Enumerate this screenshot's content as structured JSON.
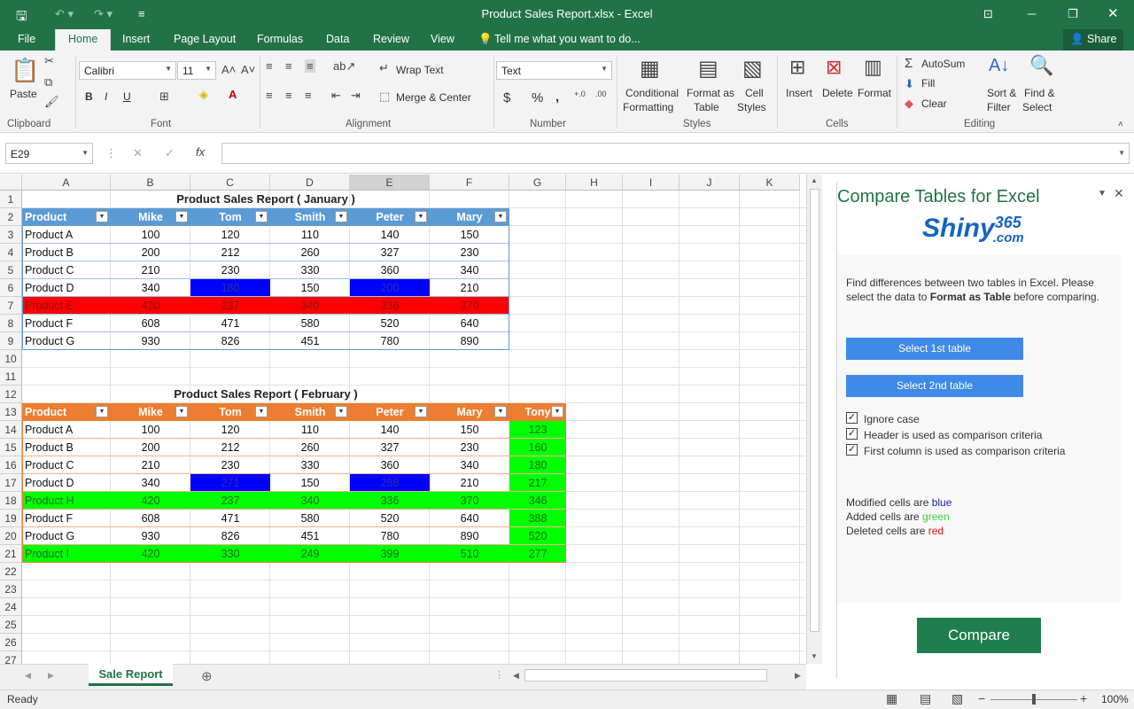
{
  "title": "Product Sales Report.xlsx - Excel",
  "ribbon_tabs": [
    "File",
    "Home",
    "Insert",
    "Page Layout",
    "Formulas",
    "Data",
    "Review",
    "View"
  ],
  "tell_me": "Tell me what you want to do...",
  "share": "Share",
  "clipboard": {
    "paste": "Paste",
    "group": "Clipboard"
  },
  "font": {
    "name": "Calibri",
    "size": "11",
    "group": "Font",
    "bold": "B",
    "italic": "I",
    "underline": "U"
  },
  "alignment": {
    "wrap": "Wrap Text",
    "merge": "Merge & Center",
    "group": "Alignment"
  },
  "number": {
    "format": "Text",
    "group": "Number",
    "currency": "$",
    "percent": "%",
    "comma": ","
  },
  "styles": {
    "cond1": "Conditional",
    "cond2": "Formatting",
    "fmt1": "Format as",
    "fmt2": "Table",
    "cell1": "Cell",
    "cell2": "Styles",
    "group": "Styles"
  },
  "cells": {
    "insert": "Insert",
    "delete": "Delete",
    "format": "Format",
    "group": "Cells"
  },
  "editing": {
    "autosum": "AutoSum",
    "fill": "Fill",
    "clear": "Clear",
    "sort1": "Sort &",
    "sort2": "Filter",
    "find1": "Find &",
    "find2": "Select",
    "group": "Editing"
  },
  "namebox": "E29",
  "fx": "fx",
  "columns": [
    "A",
    "B",
    "C",
    "D",
    "E",
    "F",
    "G",
    "H",
    "I",
    "J",
    "K"
  ],
  "rows": [
    "1",
    "2",
    "3",
    "4",
    "5",
    "6",
    "7",
    "8",
    "9",
    "10",
    "11",
    "12",
    "13",
    "14",
    "15",
    "16",
    "17",
    "18",
    "19",
    "20",
    "21",
    "22",
    "23",
    "24",
    "25",
    "26",
    "27"
  ],
  "table1": {
    "title": "Product Sales Report ( January )",
    "headers": [
      "Product",
      "Mike",
      "Tom",
      "Smith",
      "Peter",
      "Mary"
    ],
    "header_color": "#5b9bd5",
    "rows": [
      [
        "Product A",
        "100",
        "120",
        "110",
        "140",
        "150"
      ],
      [
        "Product B",
        "200",
        "212",
        "260",
        "327",
        "230"
      ],
      [
        "Product C",
        "210",
        "230",
        "330",
        "360",
        "340"
      ],
      [
        "Product D",
        "340",
        "180",
        "150",
        "200",
        "210"
      ],
      [
        "Product E",
        "420",
        "237",
        "340",
        "336",
        "370"
      ],
      [
        "Product F",
        "608",
        "471",
        "580",
        "520",
        "640"
      ],
      [
        "Product G",
        "930",
        "826",
        "451",
        "780",
        "890"
      ]
    ]
  },
  "table2": {
    "title": "Product Sales Report ( February )",
    "headers": [
      "Product",
      "Mike",
      "Tom",
      "Smith",
      "Peter",
      "Mary",
      "Tony"
    ],
    "header_color": "#ed7d31",
    "rows": [
      [
        "Product A",
        "100",
        "120",
        "110",
        "140",
        "150",
        "123"
      ],
      [
        "Product B",
        "200",
        "212",
        "260",
        "327",
        "230",
        "160"
      ],
      [
        "Product C",
        "210",
        "230",
        "330",
        "360",
        "340",
        "180"
      ],
      [
        "Product D",
        "340",
        "271",
        "150",
        "288",
        "210",
        "217"
      ],
      [
        "Product H",
        "420",
        "237",
        "340",
        "336",
        "370",
        "346"
      ],
      [
        "Product F",
        "608",
        "471",
        "580",
        "520",
        "640",
        "388"
      ],
      [
        "Product G",
        "930",
        "826",
        "451",
        "780",
        "890",
        "520"
      ],
      [
        "Product I",
        "420",
        "330",
        "249",
        "399",
        "510",
        "277"
      ]
    ]
  },
  "colors": {
    "modified": "#0000ff",
    "added": "#00ff00",
    "deleted": "#ff0000",
    "excel_green": "#217346",
    "pane_button": "#3f8ae8",
    "compare_button": "#1e7e4e"
  },
  "pane": {
    "title": "Compare Tables for Excel",
    "logo_main": "Shiny",
    "logo_num": "365",
    "logo_com": ".com",
    "desc1": "Find differences between two tables in Excel. Please",
    "desc2a": "select the data to ",
    "desc2b": "Format as Table",
    "desc2c": " before comparing.",
    "btn1": "Select 1st table",
    "btn2": "Select 2nd table",
    "opt1": "Ignore case",
    "opt2": "Header is used as comparison criteria",
    "opt3": "First column is used as comparison criteria",
    "leg1": "Modified cells are",
    "leg1v": "blue",
    "leg2": "Added cells are",
    "leg2v": "green",
    "leg3": "Deleted cells are",
    "leg3v": "red",
    "compare": "Compare"
  },
  "sheet_tab": "Sale Report",
  "status": "Ready",
  "zoom": "100%"
}
